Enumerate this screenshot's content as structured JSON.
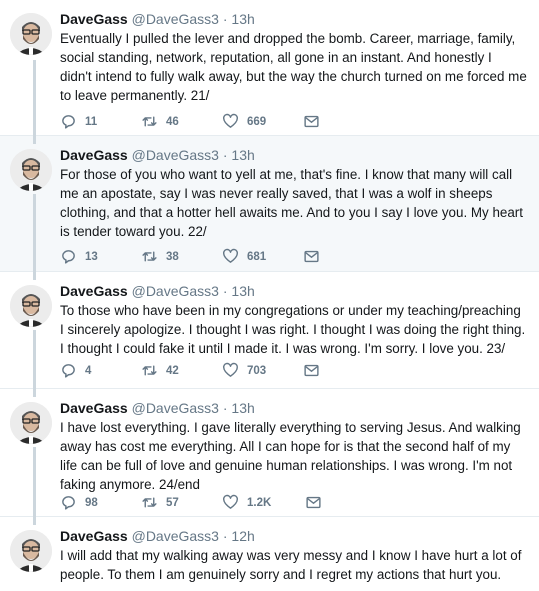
{
  "tweets": [
    {
      "name": "DaveGass",
      "handle": "@DaveGass3",
      "dot": "·",
      "time": "13h",
      "text": "Eventually I pulled the lever and dropped the bomb. Career, marriage, family, social standing, network, reputation, all gone in an instant. And honestly I didn't intend to fully walk away, but the way the church turned on me forced me to leave permanently. 21/",
      "replies": "11",
      "retweets": "46",
      "likes": "669"
    },
    {
      "name": "DaveGass",
      "handle": "@DaveGass3",
      "dot": "·",
      "time": "13h",
      "text": "For those of you who want to yell at me, that's fine. I know that many will call me an apostate, say I was never really saved, that I was a wolf in sheeps clothing, and that a hotter hell awaits me. And to you I say I love you. My heart is tender toward you. 22/",
      "replies": "13",
      "retweets": "38",
      "likes": "681"
    },
    {
      "name": "DaveGass",
      "handle": "@DaveGass3",
      "dot": "·",
      "time": "13h",
      "text": "To those who have been in my congregations or under my teaching/preaching I sincerely apologize. I thought I was right. I thought I was doing the right thing. I thought I could fake it until I made it. I was wrong. I'm sorry. I love you. 23/",
      "replies": "4",
      "retweets": "42",
      "likes": "703"
    },
    {
      "name": "DaveGass",
      "handle": "@DaveGass3",
      "dot": "·",
      "time": "13h",
      "text": "I have lost everything. I gave literally everything to serving Jesus. And walking away has cost me everything. All I can hope for is that the second half of my life can be full of love and genuine human relationships. I was wrong. I'm not faking anymore. 24/end",
      "replies": "98",
      "retweets": "57",
      "likes": "1.2K"
    },
    {
      "name": "DaveGass",
      "handle": "@DaveGass3",
      "dot": "·",
      "time": "12h",
      "text": "I will add that my walking away was very messy and I know I have hurt a lot of people. To them I am genuinely sorry and I regret my actions that hurt you."
    }
  ],
  "icons": {
    "reply": "reply-icon",
    "retweet": "retweet-icon",
    "like": "heart-icon",
    "message": "envelope-icon"
  },
  "colors": {
    "text": "#14171a",
    "muted": "#657786",
    "thread_line": "#ccd6dd",
    "highlight_bg": "#f5f8fa"
  }
}
